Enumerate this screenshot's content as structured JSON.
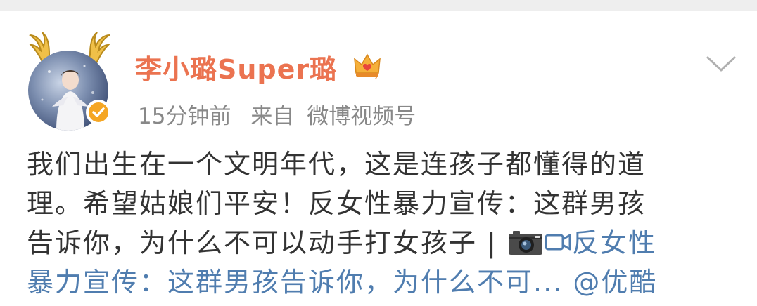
{
  "post": {
    "username": "李小璐Super璐",
    "time": "15分钟前",
    "source_prefix": "来自",
    "source_name": "微博视频号",
    "text_line1": "我们出生在一个文明年代，这是连孩子都懂得的道",
    "text_line2": "理。希望姑娘们平安！反女性暴力宣传：这群男孩",
    "text_line3_plain": "告诉你，为什么不可以动手打女孩子 | ",
    "text_line3_link": "反女性",
    "text_line4_link": "暴力宣传：这群男孩告诉你，为什么不可... @优酷"
  },
  "icons": {
    "avatar": "avatar-image",
    "antlers": "antler-decoration",
    "verified": "verified-badge-icon",
    "crown": "crown-icon",
    "chevron": "chevron-down-icon",
    "camera": "camera-emoji-icon",
    "video": "video-icon"
  },
  "colors": {
    "username": "#eb7350",
    "meta": "#888888",
    "text": "#333333",
    "link": "#507daf",
    "verified": "#f5a623"
  }
}
